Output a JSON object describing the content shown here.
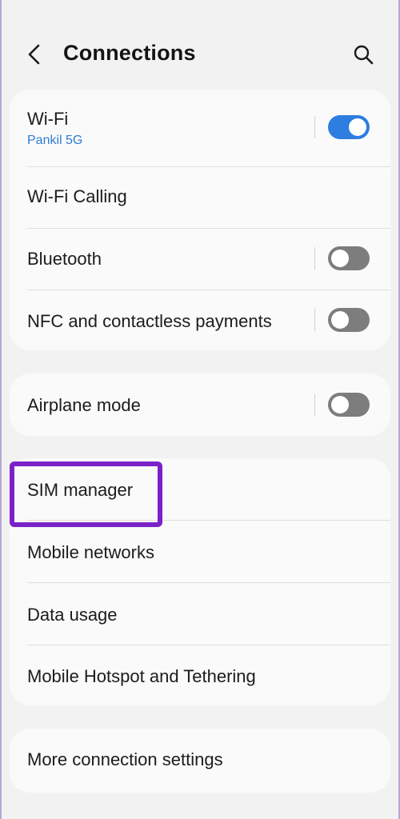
{
  "header": {
    "title": "Connections"
  },
  "colors": {
    "accent": "#2e7de0",
    "highlight": "#7a22c8"
  },
  "cards": {
    "network": {
      "wifi": {
        "label": "Wi-Fi",
        "network_name": "Pankil 5G",
        "toggle_on": true
      },
      "wifi_calling": {
        "label": "Wi-Fi Calling"
      },
      "bluetooth": {
        "label": "Bluetooth",
        "toggle_on": false
      },
      "nfc": {
        "label": "NFC and contactless payments",
        "toggle_on": false
      }
    },
    "airplane": {
      "airplane_mode": {
        "label": "Airplane mode",
        "toggle_on": false
      }
    },
    "mobile": {
      "sim_manager": {
        "label": "SIM manager"
      },
      "mobile_networks": {
        "label": "Mobile networks"
      },
      "data_usage": {
        "label": "Data usage"
      },
      "hotspot": {
        "label": "Mobile Hotspot and Tethering"
      }
    },
    "more": {
      "more_settings": {
        "label": "More connection settings"
      }
    }
  }
}
